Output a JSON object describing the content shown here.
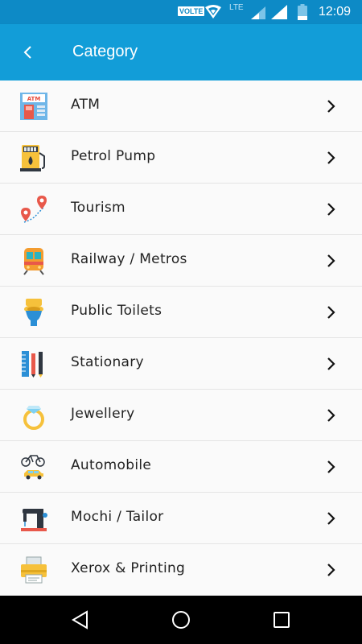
{
  "status_bar": {
    "volte": "VOLTE",
    "network": "LTE",
    "time": "12:09"
  },
  "header": {
    "title": "Category",
    "back_icon": "chevron-left-icon"
  },
  "categories": [
    {
      "label": "ATM",
      "icon": "atm-icon"
    },
    {
      "label": "Petrol Pump",
      "icon": "fuel-pump-icon"
    },
    {
      "label": "Tourism",
      "icon": "map-pins-icon"
    },
    {
      "label": "Railway / Metros",
      "icon": "train-icon"
    },
    {
      "label": "Public Toilets",
      "icon": "toilet-icon"
    },
    {
      "label": "Stationary",
      "icon": "stationery-icon"
    },
    {
      "label": "Jewellery",
      "icon": "ring-icon"
    },
    {
      "label": "Automobile",
      "icon": "bicycle-car-icon"
    },
    {
      "label": "Mochi / Tailor",
      "icon": "sewing-machine-icon"
    },
    {
      "label": "Xerox & Printing",
      "icon": "printer-icon"
    }
  ],
  "colors": {
    "status_bar": "#0d8ac6",
    "app_bar": "#129dd8",
    "background": "#fafafa"
  },
  "nav": {
    "back": "nav-back-icon",
    "home": "nav-home-icon",
    "recents": "nav-recents-icon"
  }
}
